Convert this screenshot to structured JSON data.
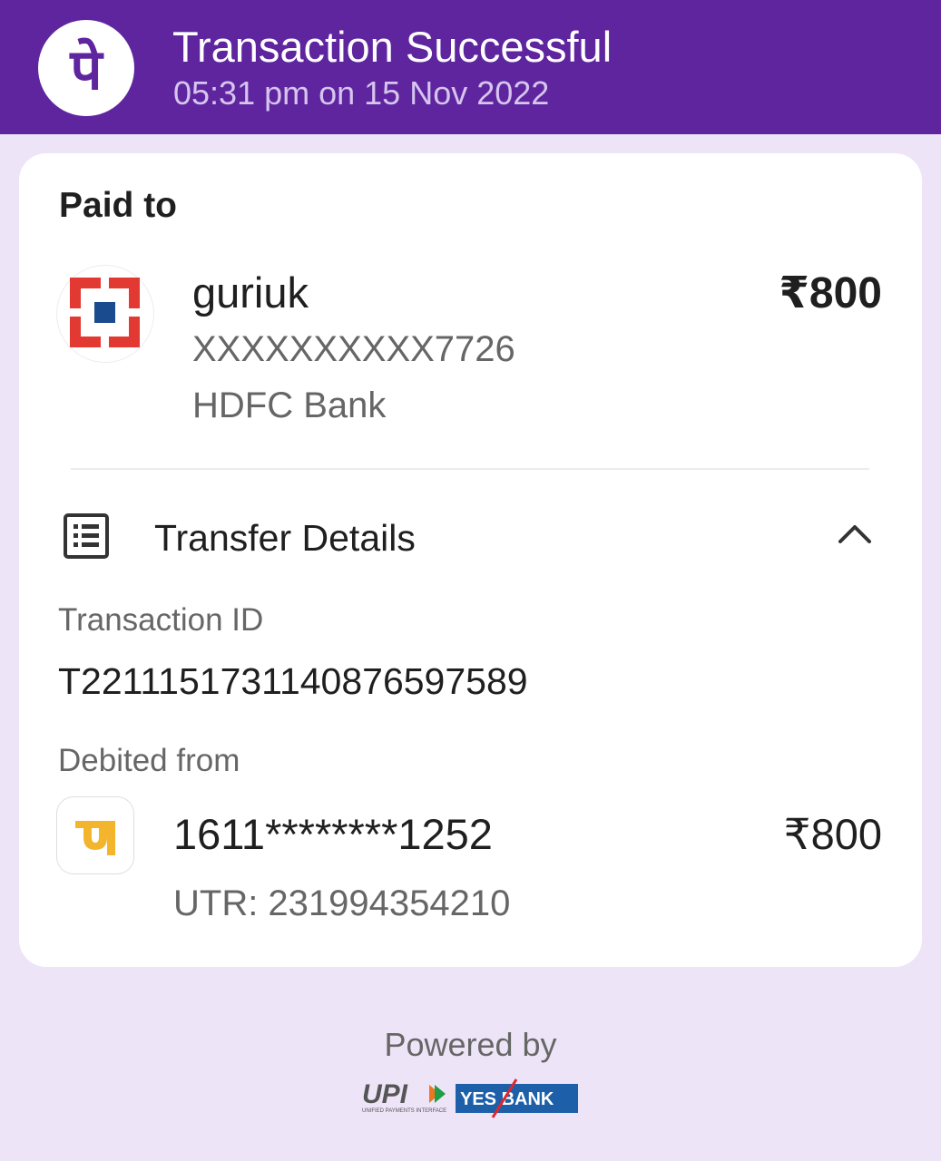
{
  "header": {
    "title": "Transaction Successful",
    "datetime": "05:31 pm on 15 Nov 2022",
    "logo_text": "पे",
    "bg_color": "#5f259f"
  },
  "paid_to": {
    "section_label": "Paid to",
    "name": "guriuk",
    "account": "XXXXXXXXXX7726",
    "bank": "HDFC Bank",
    "amount": "₹800",
    "bank_icon": "hdfc-bank-logo"
  },
  "transfer_details": {
    "title": "Transfer Details",
    "expanded": true,
    "transaction_id_label": "Transaction ID",
    "transaction_id": "T2211151731140876597589",
    "debited_from_label": "Debited from",
    "debit_account": "1611********1252",
    "debit_amount": "₹800",
    "utr": "UTR: 231994354210",
    "debit_bank_icon": "pnb-bank-logo"
  },
  "footer": {
    "powered_by": "Powered by",
    "upi_logo_text": "UPI",
    "upi_tagline": "UNIFIED PAYMENTS INTERFACE",
    "yes_bank_text": "YES BANK"
  }
}
